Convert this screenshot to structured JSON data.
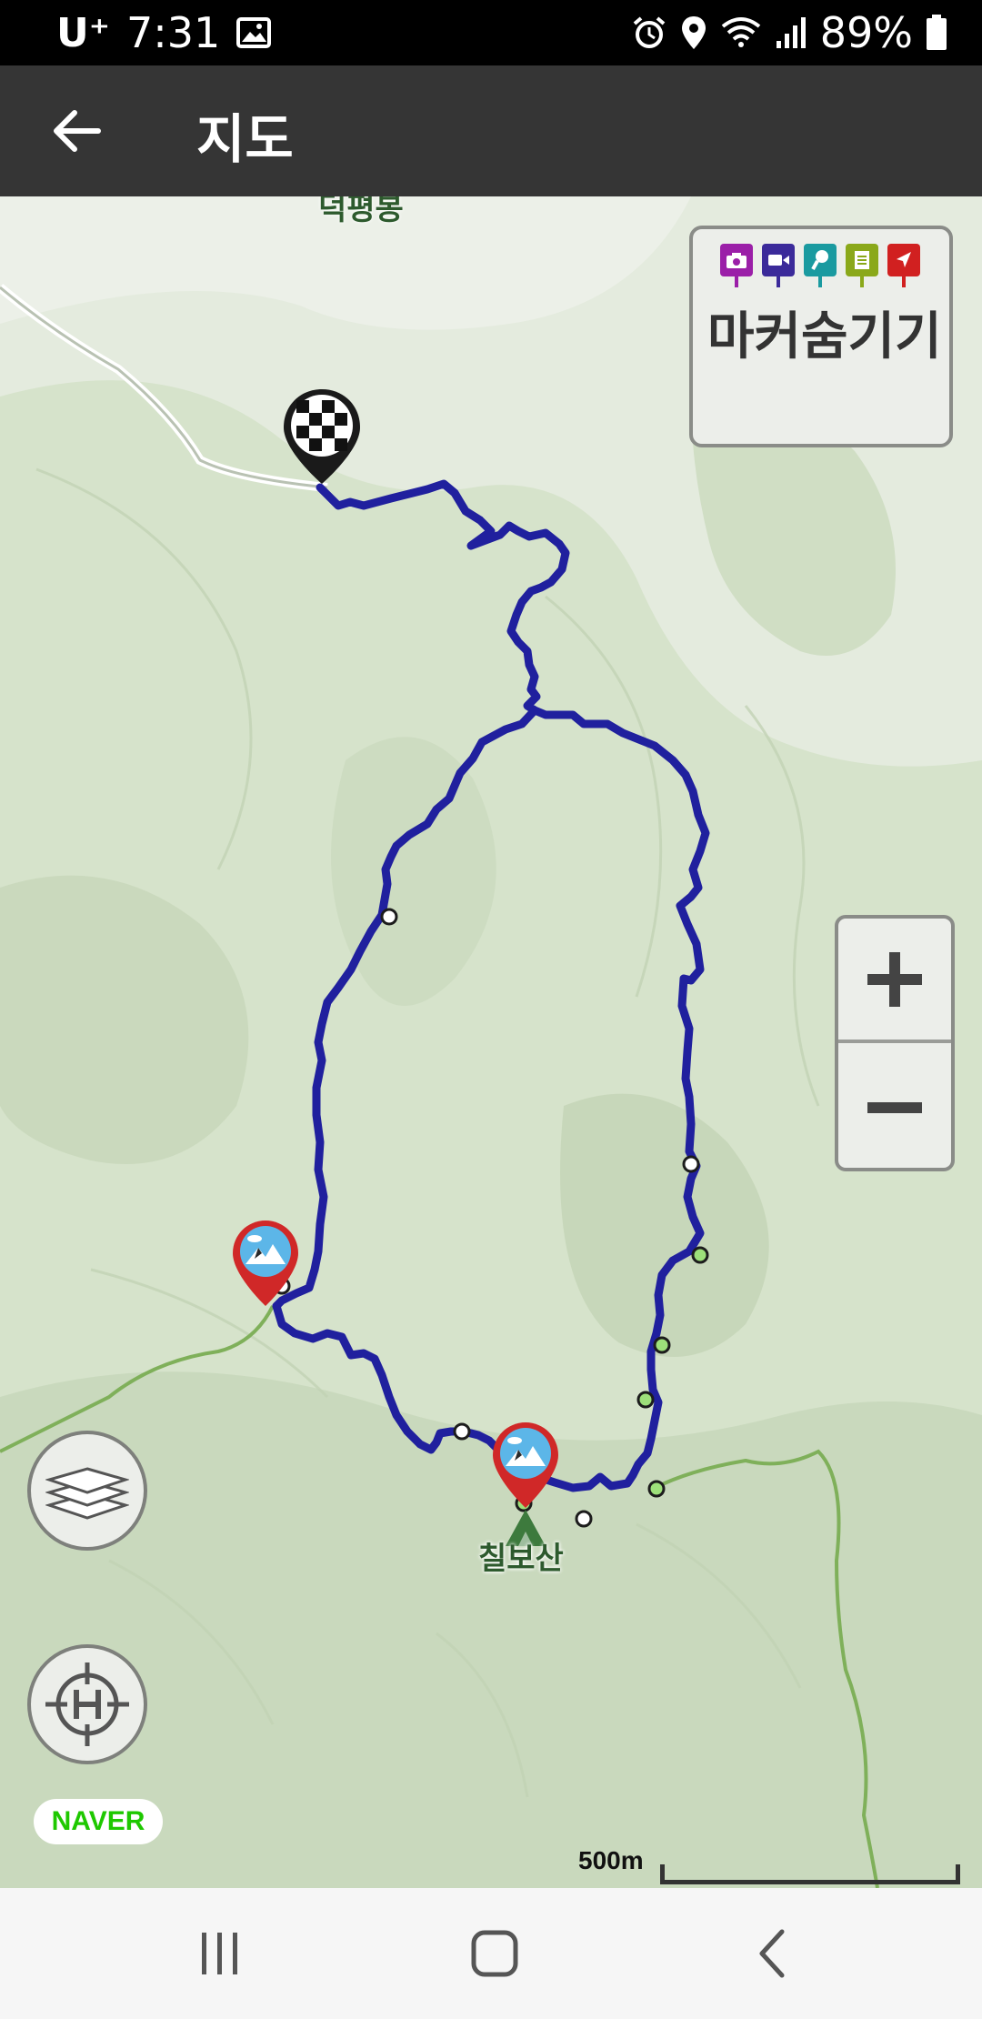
{
  "status_bar": {
    "carrier": "U⁺",
    "time": "7:31",
    "battery": "89%",
    "icons": [
      "gallery-icon",
      "alarm-icon",
      "location-icon",
      "wifi-icon",
      "signal-icon",
      "battery-icon"
    ]
  },
  "app_bar": {
    "title": "지도",
    "back_icon": "arrow-left-icon"
  },
  "map": {
    "provider_logo": "NAVER",
    "scale_label": "500m",
    "peak_label": "칠보산",
    "top_label": "덕평봉",
    "marker_panel": {
      "label": "마커숨기기",
      "marker_icons": [
        {
          "name": "photo-marker-icon",
          "color": "#9b1fa8"
        },
        {
          "name": "video-marker-icon",
          "color": "#3b2a9a"
        },
        {
          "name": "voice-marker-icon",
          "color": "#1a9aa0"
        },
        {
          "name": "memo-marker-icon",
          "color": "#8aa81a"
        },
        {
          "name": "location-marker-icon",
          "color": "#d12020"
        }
      ]
    },
    "track_color": "#1f1fa0",
    "controls": {
      "zoom_in": "+",
      "zoom_out": "−",
      "layers_icon": "layers-icon",
      "gps_icon": "gps-home-icon"
    }
  },
  "nav_bar": {
    "icons": [
      "recent-apps-icon",
      "home-icon",
      "back-nav-icon"
    ]
  }
}
